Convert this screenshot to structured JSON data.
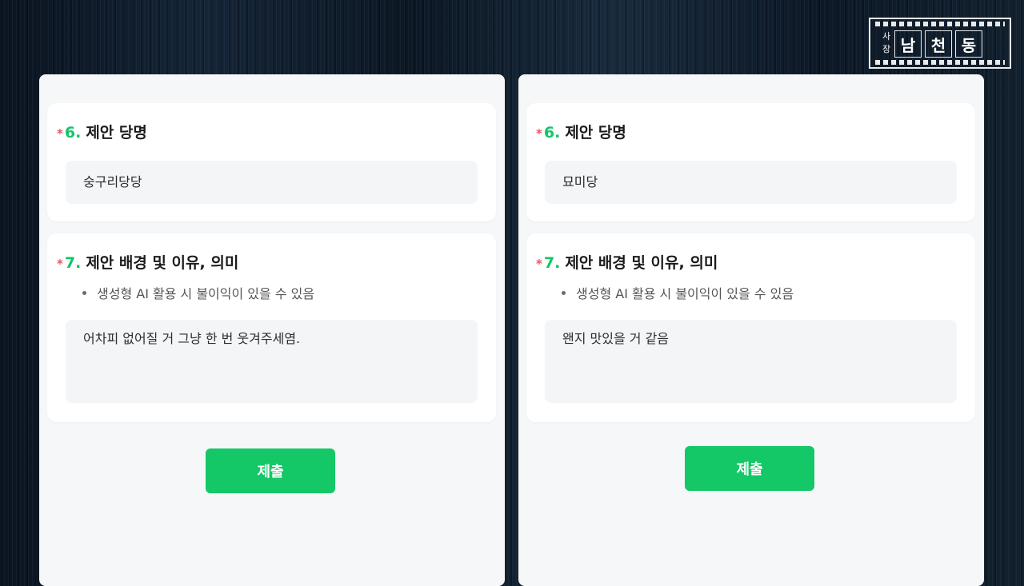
{
  "logo": {
    "small": [
      "사",
      "장"
    ],
    "chars": [
      "남",
      "천",
      "동"
    ]
  },
  "forms": [
    {
      "q6": {
        "star": "*",
        "number": "6.",
        "title": "제안 당명",
        "answer": "숭구리당당"
      },
      "q7": {
        "star": "*",
        "number": "7.",
        "title": "제안 배경 및 이유, 의미",
        "hint": "생성형  AI 활용 시 불이익이 있을 수 있음",
        "answer": "어차피 없어질 거 그냥 한 번 웃겨주세염."
      },
      "submit_label": "제출"
    },
    {
      "q6": {
        "star": "*",
        "number": "6.",
        "title": "제안 당명",
        "answer": "묘미당"
      },
      "q7": {
        "star": "*",
        "number": "7.",
        "title": "제안 배경 및 이유, 의미",
        "hint": "생성형  AI 활용 시 불이익이 있을 수 있음",
        "answer": "왠지 맛있을 거 같음"
      },
      "submit_label": "제출"
    }
  ],
  "colors": {
    "accent": "#14c767",
    "number": "#14c46a",
    "required_star": "#f0535d"
  }
}
